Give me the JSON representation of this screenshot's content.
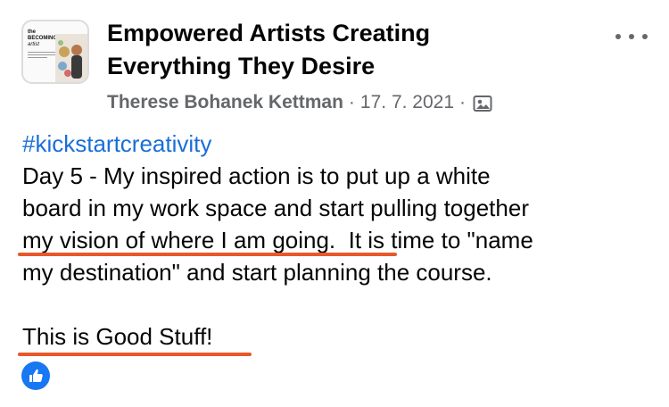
{
  "group": {
    "title_line1": "Empowered Artists Creating",
    "title_line2": "Everything They Desire",
    "thumb_logo_line1": "the",
    "thumb_logo_line2": "BECOMING",
    "thumb_logo_line3": "artist"
  },
  "meta": {
    "author": "Therese Bohanek Kettman",
    "date": "17. 7. 2021",
    "separator": "·",
    "privacy_icon": "photo-frame-icon"
  },
  "post": {
    "hashtag": "#kickstartcreativity",
    "lines": [
      "Day 5 - My inspired action is to put up a white",
      "board in my work space and start pulling together",
      "my vision of where I am going.  It is time to \"name",
      "my destination\" and start planning the course."
    ],
    "closing": "This is Good Stuff!"
  },
  "reactions": {
    "icon": "thumbs-up-icon"
  },
  "colors": {
    "link": "#1a6ed8",
    "underline": "#e8582a",
    "like": "#1877f2",
    "meta": "#65676b"
  }
}
